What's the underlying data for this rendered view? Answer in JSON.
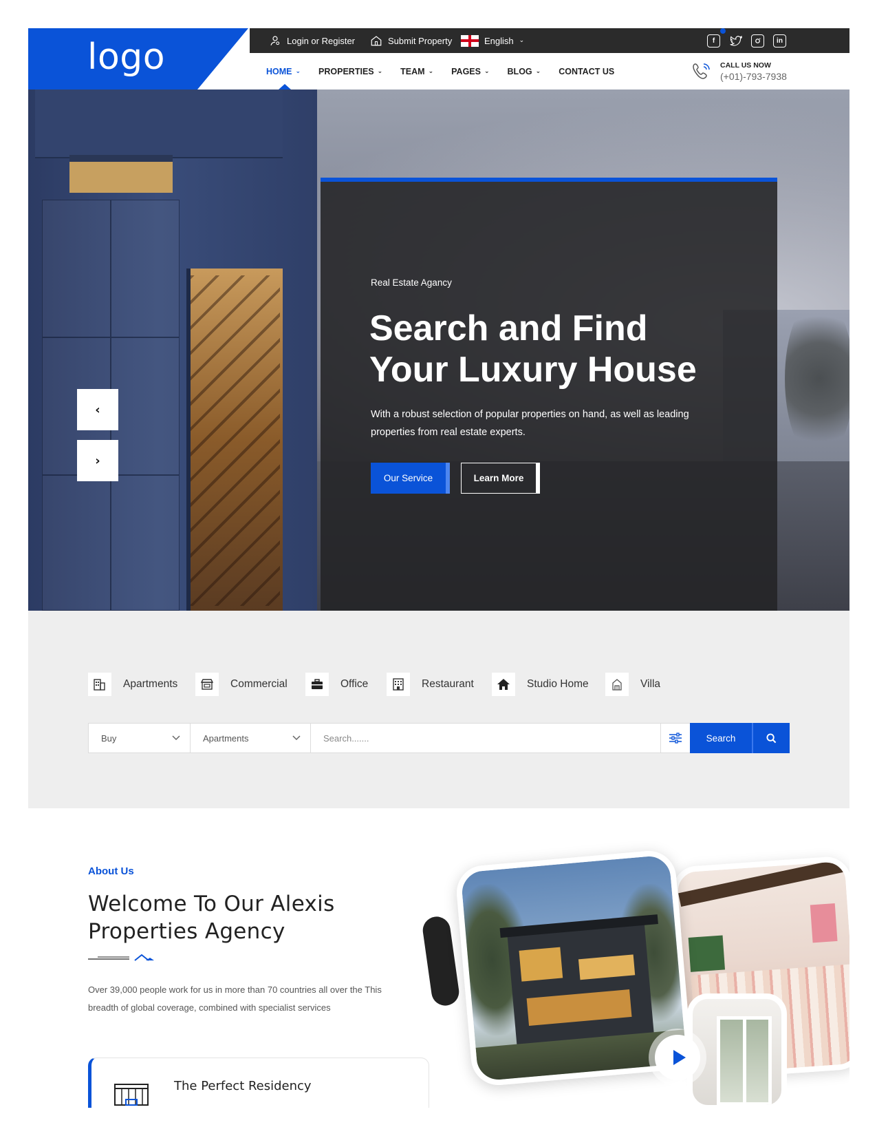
{
  "brand": {
    "logo": "logo",
    "accent": "#0a53d8",
    "topbar_bg": "#2b2b2b"
  },
  "topbar": {
    "login_label": "Login or Register",
    "submit_label": "Submit Property",
    "language": "English",
    "social_icons": [
      "facebook-icon",
      "twitter-icon",
      "instagram-icon",
      "linkedin-icon"
    ]
  },
  "nav": {
    "items": [
      {
        "label": "HOME",
        "has_dropdown": true,
        "active": true
      },
      {
        "label": "PROPERTIES",
        "has_dropdown": true
      },
      {
        "label": "TEAM",
        "has_dropdown": true
      },
      {
        "label": "PAGES",
        "has_dropdown": true
      },
      {
        "label": "BLOG",
        "has_dropdown": true
      },
      {
        "label": "CONTACT US",
        "has_dropdown": false
      }
    ]
  },
  "call": {
    "label": "CALL US NOW",
    "number": "(+01)-793-7938"
  },
  "hero": {
    "kicker": "Real Estate Agancy",
    "title_line1": "Search and Find",
    "title_line2": "Your Luxury House",
    "description": "With a robust selection of popular properties on hand, as well as leading properties from real estate experts.",
    "primary_button": "Our Service",
    "secondary_button": "Learn More"
  },
  "categories": [
    {
      "label": "Apartments",
      "icon": "apartment-building-icon"
    },
    {
      "label": "Commercial",
      "icon": "storefront-icon"
    },
    {
      "label": "Office",
      "icon": "briefcase-icon"
    },
    {
      "label": "Restaurant",
      "icon": "restaurant-building-icon"
    },
    {
      "label": "Studio Home",
      "icon": "home-icon"
    },
    {
      "label": "Villa",
      "icon": "villa-icon"
    }
  ],
  "search": {
    "mode_value": "Buy",
    "type_value": "Apartments",
    "placeholder": "Search.......",
    "button_label": "Search"
  },
  "about": {
    "kicker": "About Us",
    "title_line1": "Welcome To Our Alexis",
    "title_line2": "Properties Agency",
    "text": "Over 39,000 people work for us in more than 70 countries all over the This breadth of global coverage, combined with specialist services",
    "feature_title": "The Perfect Residency"
  }
}
